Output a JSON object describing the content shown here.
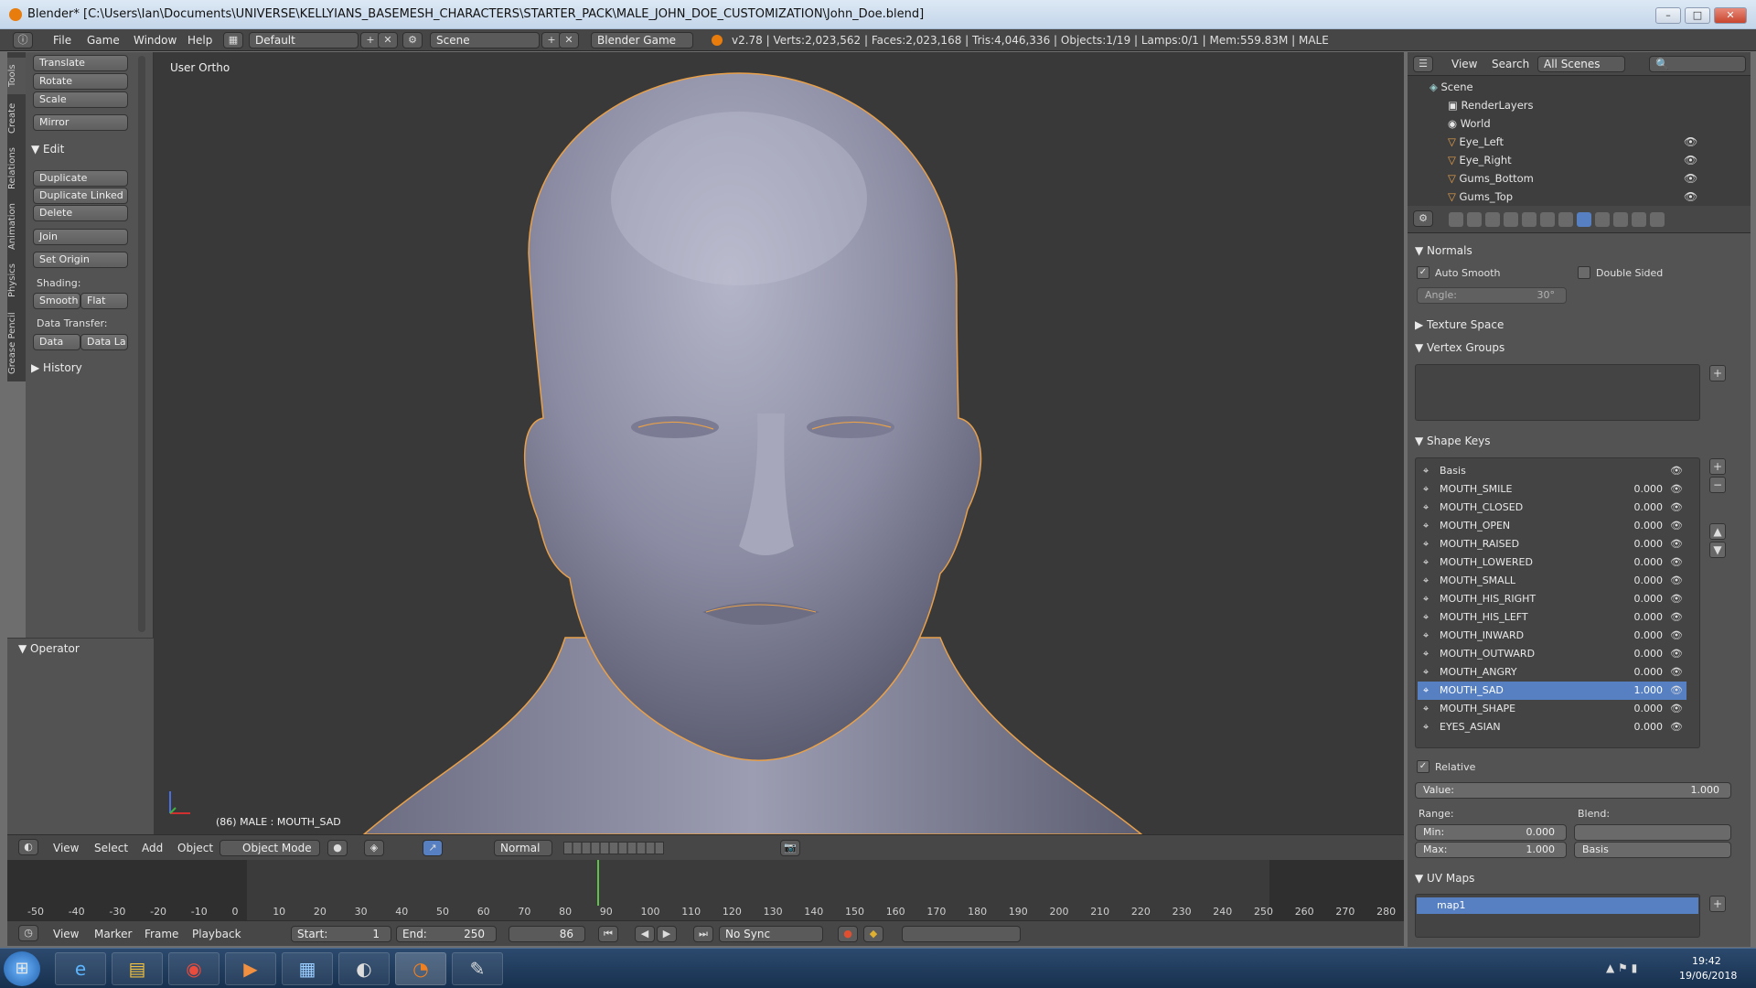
{
  "window": {
    "title": "Blender* [C:\\Users\\Ian\\Documents\\UNIVERSE\\KELLYIANS_BASEMESH_CHARACTERS\\STARTER_PACK\\MALE_JOHN_DOE_CUSTOMIZATION\\John_Doe.blend]",
    "min": "–",
    "max": "□",
    "close": "✕"
  },
  "info": {
    "menus": [
      "File",
      "Game",
      "Window",
      "Help"
    ],
    "layout": "Default",
    "scene": "Scene",
    "engine": "Blender Game",
    "stats": "v2.78 | Verts:2,023,562 | Faces:2,023,168 | Tris:4,046,336 | Objects:1/19 | Lamps:0/1 | Mem:559.83M | MALE"
  },
  "toolshelf": {
    "tabs": [
      "Tools",
      "Create",
      "Relations",
      "Animation",
      "Physics",
      "Grease Pencil"
    ],
    "transform": [
      "Translate",
      "Rotate",
      "Scale"
    ],
    "mirror": "Mirror",
    "edit_header": "Edit",
    "edit": [
      "Duplicate",
      "Duplicate Linked",
      "Delete"
    ],
    "join": "Join",
    "set_origin": "Set Origin",
    "shading_label": "Shading:",
    "smooth": "Smooth",
    "flat": "Flat",
    "data_transfer_label": "Data Transfer:",
    "data": "Data",
    "data_la": "Data La",
    "history": "History",
    "operator": "Operator"
  },
  "viewport": {
    "view_label": "User Ortho",
    "object_label": "(86) MALE : MOUTH_SAD"
  },
  "viewport_header": {
    "menus": [
      "View",
      "Select",
      "Add",
      "Object"
    ],
    "mode": "Object Mode",
    "orientation": "Normal"
  },
  "timeline": {
    "ticks": [
      "-50",
      "-40",
      "-30",
      "-20",
      "-10",
      "0",
      "10",
      "20",
      "30",
      "40",
      "50",
      "60",
      "70",
      "80",
      "90",
      "100",
      "110",
      "120",
      "130",
      "140",
      "150",
      "160",
      "170",
      "180",
      "190",
      "200",
      "210",
      "220",
      "230",
      "240",
      "250",
      "260",
      "270",
      "280"
    ],
    "menus": [
      "View",
      "Marker",
      "Frame",
      "Playback"
    ],
    "start_label": "Start:",
    "start": "1",
    "end_label": "End:",
    "end": "250",
    "current": "86",
    "sync": "No Sync"
  },
  "outliner": {
    "menus": [
      "View",
      "Search"
    ],
    "filter": "All Scenes",
    "rows": [
      "Scene",
      "RenderLayers",
      "World",
      "Eye_Left",
      "Eye_Right",
      "Gums_Bottom",
      "Gums_Top"
    ]
  },
  "properties": {
    "normals": "Normals",
    "auto_smooth": "Auto Smooth",
    "double_sided": "Double Sided",
    "angle_label": "Angle:",
    "angle": "30°",
    "texture_space": "Texture Space",
    "vertex_groups": "Vertex Groups",
    "shape_keys": "Shape Keys",
    "keys": [
      {
        "name": "Basis",
        "value": ""
      },
      {
        "name": "MOUTH_SMILE",
        "value": "0.000"
      },
      {
        "name": "MOUTH_CLOSED",
        "value": "0.000"
      },
      {
        "name": "MOUTH_OPEN",
        "value": "0.000"
      },
      {
        "name": "MOUTH_RAISED",
        "value": "0.000"
      },
      {
        "name": "MOUTH_LOWERED",
        "value": "0.000"
      },
      {
        "name": "MOUTH_SMALL",
        "value": "0.000"
      },
      {
        "name": "MOUTH_HIS_RIGHT",
        "value": "0.000"
      },
      {
        "name": "MOUTH_HIS_LEFT",
        "value": "0.000"
      },
      {
        "name": "MOUTH_INWARD",
        "value": "0.000"
      },
      {
        "name": "MOUTH_OUTWARD",
        "value": "0.000"
      },
      {
        "name": "MOUTH_ANGRY",
        "value": "0.000"
      },
      {
        "name": "MOUTH_SAD",
        "value": "1.000"
      },
      {
        "name": "MOUTH_SHAPE",
        "value": "0.000"
      },
      {
        "name": "EYES_ASIAN",
        "value": "0.000"
      }
    ],
    "selected_key": "MOUTH_SAD",
    "relative": "Relative",
    "value_label": "Value:",
    "value": "1.000",
    "range_label": "Range:",
    "min_label": "Min:",
    "min": "0.000",
    "max_label": "Max:",
    "max": "1.000",
    "blend_label": "Blend:",
    "blend": "Basis",
    "uv_maps": "UV Maps",
    "uv_map": "map1"
  },
  "taskbar": {
    "clock_time": "19:42",
    "clock_date": "19/06/2018"
  },
  "colors": {
    "selection": "#5680c2",
    "outline": "#e8a04a",
    "playhead": "#5fc04a"
  }
}
